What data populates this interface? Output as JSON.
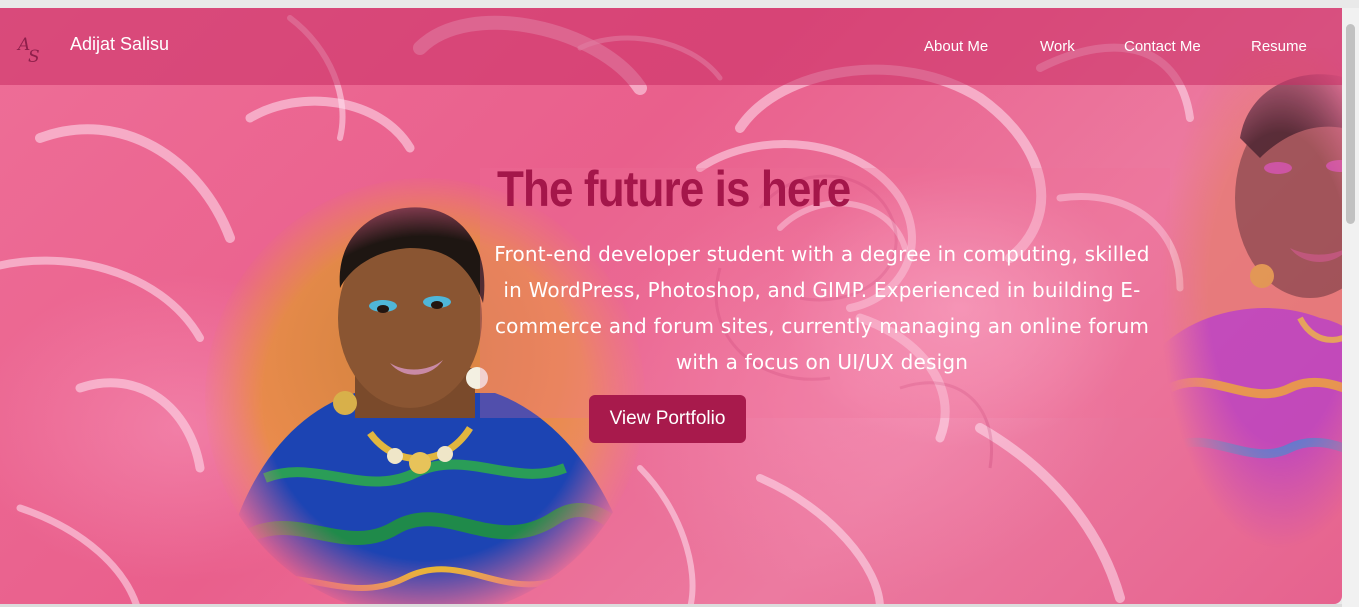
{
  "navbar": {
    "logo_text": "AS",
    "brand": "Adijat Salisu",
    "links": [
      "About Me",
      "Work",
      "Contact Me",
      "Resume"
    ]
  },
  "hero": {
    "title": "The future is here",
    "description": "Front-end developer student with a degree in computing, skilled in WordPress, Photoshop, and GIMP. Experienced in building E-commerce and forum sites, currently managing an online forum with a focus on UI/UX design",
    "button_label": "View Portfolio"
  },
  "colors": {
    "accent": "#a81a4c",
    "title": "#a4164a",
    "navbar": "#c82d64",
    "background": "#ec6e97"
  },
  "icons": {
    "logo": "monogram-logo-icon"
  }
}
